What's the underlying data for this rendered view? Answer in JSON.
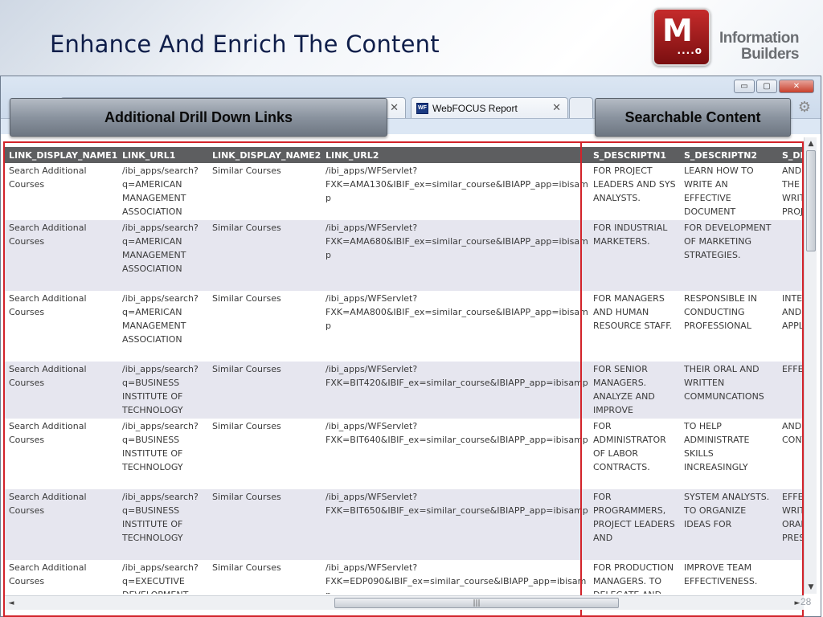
{
  "slide": {
    "title": "Enhance And Enrich The Content",
    "page_number": "28"
  },
  "logo": {
    "letter": "M",
    "dots": "....o",
    "brand_line1": "Information",
    "brand_line2": "Builders"
  },
  "window": {
    "minimize_label": "▭",
    "maximize_label": "▢",
    "close_label": "✕",
    "tabs": [
      {
        "label": "",
        "close": "✕"
      },
      {
        "icon": "WF",
        "label": "WebFOCUS Report",
        "close": "✕"
      }
    ],
    "gear_icon": "⚙"
  },
  "callouts": {
    "left": "Additional Drill Down Links",
    "right": "Searchable Content"
  },
  "table": {
    "columns": [
      "LINK_DISPLAY_NAME1",
      "LINK_URL1",
      "LINK_DISPLAY_NAME2",
      "LINK_URL2",
      "S_DESCRIPTN1",
      "S_DESCRIPTN2",
      "S_DE"
    ],
    "rows": [
      [
        "Search Additional\nCourses",
        "/ibi_apps/search?\nq=AMERICAN\nMANAGEMENT\nASSOCIATION",
        "Similar Courses",
        "/ibi_apps/WFServlet?\nFXK=AMA130&IBIF_ex=similar_course&IBIAPP_app=ibisamp",
        "FOR PROJECT\nLEADERS AND SYS\nANALYSTS.",
        "LEARN HOW TO\nWRITE AN\nEFFECTIVE\nDOCUMENT",
        "AND\nTHE\nWRIT\nPROJ"
      ],
      [
        "Search Additional\nCourses",
        "/ibi_apps/search?\nq=AMERICAN\nMANAGEMENT\nASSOCIATION",
        "Similar Courses",
        "/ibi_apps/WFServlet?\nFXK=AMA680&IBIF_ex=similar_course&IBIAPP_app=ibisamp",
        "FOR INDUSTRIAL\nMARKETERS.",
        "FOR DEVELOPMENT\nOF MARKETING\nSTRATEGIES.",
        ""
      ],
      [
        "Search Additional\nCourses",
        "/ibi_apps/search?\nq=AMERICAN\nMANAGEMENT\nASSOCIATION",
        "Similar Courses",
        "/ibi_apps/WFServlet?\nFXK=AMA800&IBIF_ex=similar_course&IBIAPP_app=ibisamp",
        "FOR MANAGERS\nAND HUMAN\nRESOURCE STAFF.",
        "RESPONSIBLE IN\nCONDUCTING\nPROFESSIONAL",
        "INTE\nAND\nAPPL"
      ],
      [
        "Search Additional\nCourses",
        "/ibi_apps/search?\nq=BUSINESS\nINSTITUTE OF\nTECHNOLOGY",
        "Similar Courses",
        "/ibi_apps/WFServlet?\nFXK=BIT420&IBIF_ex=similar_course&IBIAPP_app=ibisamp",
        "FOR SENIOR\nMANAGERS.\nANALYZE AND\nIMPROVE",
        "THEIR ORAL AND\nWRITTEN\nCOMMUNCATIONS",
        "EFFE"
      ],
      [
        "Search Additional\nCourses",
        "/ibi_apps/search?\nq=BUSINESS\nINSTITUTE OF\nTECHNOLOGY",
        "Similar Courses",
        "/ibi_apps/WFServlet?\nFXK=BIT640&IBIF_ex=similar_course&IBIAPP_app=ibisamp",
        "FOR\nADMINISTRATOR\nOF LABOR\nCONTRACTS.",
        "TO HELP\nADMINISTRATE\nSKILLS\nINCREASINGLY",
        "AND\nCONT"
      ],
      [
        "Search Additional\nCourses",
        "/ibi_apps/search?\nq=BUSINESS\nINSTITUTE OF\nTECHNOLOGY",
        "Similar Courses",
        "/ibi_apps/WFServlet?\nFXK=BIT650&IBIF_ex=similar_course&IBIAPP_app=ibisamp",
        "FOR\nPROGRAMMERS,\nPROJECT LEADERS\nAND",
        "SYSTEM ANALYSTS.\nTO ORGANIZE\nIDEAS FOR",
        "EFFE\nWRIT\nORAL\nPRES"
      ],
      [
        "Search Additional\nCourses",
        "/ibi_apps/search?\nq=EXECUTIVE\nDEVELOPMENT",
        "Similar Courses",
        "/ibi_apps/WFServlet?\nFXK=EDP090&IBIF_ex=similar_course&IBIAPP_app=ibisamp",
        "FOR PRODUCTION\nMANAGERS. TO\nDELEGATE AND",
        "IMPROVE TEAM\nEFFECTIVENESS.",
        ""
      ]
    ]
  },
  "scrollbars": {
    "up_arrow": "▲",
    "down_arrow": "▼",
    "left_arrow": "◄",
    "right_arrow": "►",
    "grip": "|||"
  }
}
